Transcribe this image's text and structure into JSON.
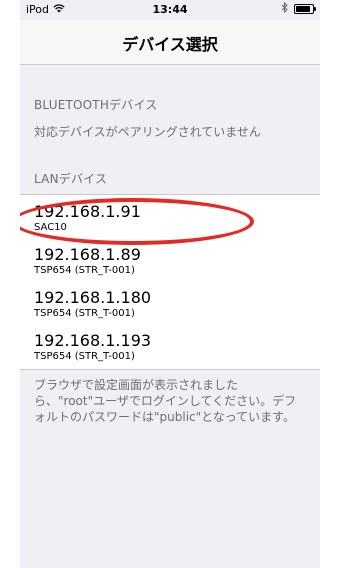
{
  "status_bar": {
    "carrier": "iPod",
    "time": "13:44",
    "icons": [
      "wifi-icon",
      "bluetooth-icon",
      "battery-icon"
    ]
  },
  "nav": {
    "title": "デバイス選択"
  },
  "bluetooth": {
    "header": "BLUETOOTHデバイス",
    "empty_message": "対応デバイスがペアリングされていません"
  },
  "lan": {
    "header": "LANデバイス",
    "devices": [
      {
        "ip": "192.168.1.91",
        "model": "SAC10"
      },
      {
        "ip": "192.168.1.89",
        "model": "TSP654 (STR_T-001)"
      },
      {
        "ip": "192.168.1.180",
        "model": "TSP654 (STR_T-001)"
      },
      {
        "ip": "192.168.1.193",
        "model": "TSP654 (STR_T-001)"
      }
    ],
    "footer": "ブラウザで設定画面が表示されましたら、\"root\"ユーザでログインしてください。デフォルトのパスワードは\"public\"となっています。"
  },
  "colors": {
    "background": "#efeff4",
    "annotation": "#e32b23"
  }
}
